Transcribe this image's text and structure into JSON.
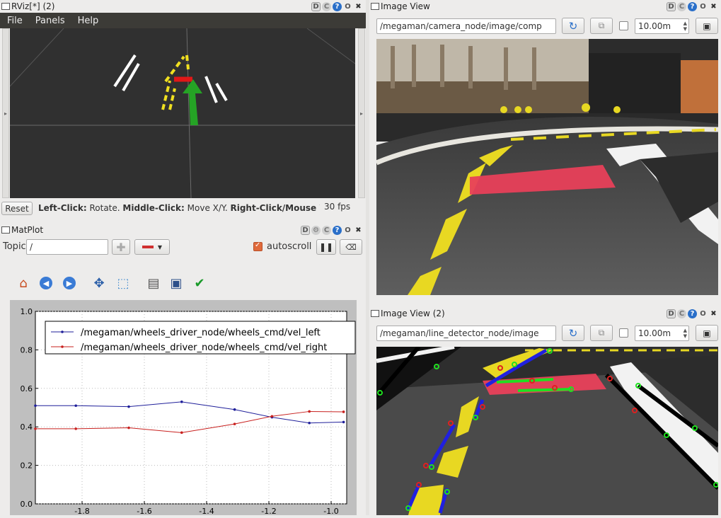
{
  "rviz": {
    "title": "RViz[*] (2)",
    "menu": [
      "File",
      "Panels",
      "Help"
    ],
    "reset_label": "Reset",
    "status": {
      "left_click_label": "Left-Click:",
      "left_click_text": "Rotate.",
      "middle_click_label": "Middle-Click:",
      "middle_click_text": "Move X/Y.",
      "right_click_label": "Right-Click/Mouse W",
      "fps": "30 fps"
    }
  },
  "matplot": {
    "title": "MatPlot",
    "topic_label": "Topic",
    "topic_value": "/",
    "autoscroll_label": "autoscroll",
    "autoscroll_checked": true,
    "toolbar_icons": [
      "home-icon",
      "back-icon",
      "forward-icon",
      "pan-icon",
      "zoom-icon",
      "configure-icon",
      "save-icon",
      "check-icon"
    ]
  },
  "image_view_1": {
    "title": "Image View",
    "topic": "/megaman/camera_node/image/comp",
    "range": "10.00m"
  },
  "image_view_2": {
    "title": "Image View (2)",
    "topic": "/megaman/line_detector_node/image",
    "range": "10.00m"
  },
  "title_buttons": {
    "d": "D",
    "q": "?",
    "o": "O",
    "x": "✖"
  },
  "chart_data": {
    "type": "line",
    "xlim": [
      -1.95,
      -0.95
    ],
    "ylim": [
      0.0,
      1.0
    ],
    "xticks": [
      "-1.8",
      "-1.6",
      "-1.4",
      "-1.2",
      "-1.0"
    ],
    "yticks": [
      "0.0",
      "0.2",
      "0.4",
      "0.6",
      "0.8",
      "1.0"
    ],
    "grid": true,
    "legend_position": "top",
    "series": [
      {
        "name": "/megaman/wheels_driver_node/wheels_cmd/vel_left",
        "color": "#1f1f9a",
        "x": [
          -1.95,
          -1.82,
          -1.65,
          -1.48,
          -1.31,
          -1.19,
          -1.07,
          -0.96
        ],
        "y": [
          0.51,
          0.51,
          0.505,
          0.53,
          0.49,
          0.45,
          0.42,
          0.425
        ]
      },
      {
        "name": "/megaman/wheels_driver_node/wheels_cmd/vel_right",
        "color": "#c8201e",
        "x": [
          -1.95,
          -1.82,
          -1.65,
          -1.48,
          -1.31,
          -1.19,
          -1.07,
          -0.96
        ],
        "y": [
          0.39,
          0.39,
          0.395,
          0.37,
          0.415,
          0.455,
          0.48,
          0.478
        ]
      }
    ]
  }
}
